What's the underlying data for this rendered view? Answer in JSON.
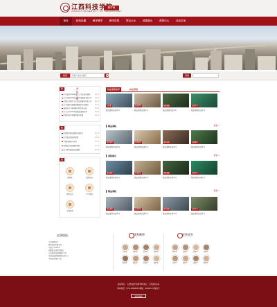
{
  "header": {
    "logo_text": "江西科技学院",
    "logo_sub": "JIANGXI UNIVERSITY OF TECHNOLOGY",
    "badge": "教学网"
  },
  "nav": {
    "items": [
      "首页",
      "机构设置",
      "教学教学",
      "教学改革",
      "项目公示",
      "成果展示",
      "资源中心",
      "互动交流"
    ],
    "active_index": 0
  },
  "search": {
    "label": "搜索",
    "placeholder": "请输入搜索关键词",
    "login_label": "登录"
  },
  "sidebar": {
    "news": {
      "tab_active": "新闻动态",
      "tab_other": "通知公告",
      "items": [
        {
          "text": "关于做好2019年教学工作安排的通知",
          "date": "03-18"
        },
        {
          "text": "关于开展2019年度教学成果奖申报工作",
          "date": "03-15"
        },
        {
          "text": "学院召开教学工作会议部署新学期工作",
          "date": "03-12"
        },
        {
          "text": "关于组织申报省级教改项目的通知",
          "date": "03-10"
        },
        {
          "text": "教务处关于期中教学检查的安排",
          "date": "03-08"
        },
        {
          "text": "关于公布2018年度精品课程名单",
          "date": "03-05"
        },
        {
          "text": "学院举办青年教师教学竞赛",
          "date": "03-01"
        }
      ]
    },
    "hot": {
      "title": "热门课程",
      "items": [
        {
          "text": "高等数学精品课程在线学习",
          "date": "03-18"
        },
        {
          "text": "大学英语视听说课程",
          "date": "03-16"
        },
        {
          "text": "计算机基础与应用",
          "date": "03-14"
        },
        {
          "text": "机械设计基础课程资源",
          "date": "03-12"
        },
        {
          "text": "电子商务概论在线课程",
          "date": "03-09"
        }
      ]
    },
    "services": {
      "title": "校园服务",
      "items": [
        "课程表",
        "成绩查询",
        "教学日历",
        "学习资源",
        "在线咨询",
        "图书馆"
      ]
    }
  },
  "main": {
    "tabs": [
      "精品课程推荐",
      "精品课程"
    ],
    "sections": [
      {
        "title": "精品课程",
        "more": "更多>>"
      },
      {
        "title": "精品课程",
        "more": "更多>>"
      },
      {
        "title": "课程展示",
        "more": "更多>>"
      },
      {
        "title": "精品课程",
        "more": "更多>>"
      }
    ],
    "cards": [
      [
        "公开课",
        "名师课堂",
        "微课展播",
        "在线学习"
      ],
      [
        "精品课程",
        "名师课堂",
        "教学视频",
        "实践教学"
      ],
      [
        "精品课程",
        "名师课堂",
        "微课展播",
        "在线学习"
      ],
      [
        "精品课程",
        "名师课堂",
        "教学视频",
        "在线学习"
      ]
    ],
    "card_caption": "精品课程在线学习"
  },
  "lower": {
    "links_title": "友情链接",
    "links": [
      "江西省教育厅",
      "教育部高等教育司",
      "中国大学MOOC",
      "国家精品课程资源网",
      "江西省高校网络教学平台",
      "全国高校教师网络培训中心",
      "中国高等教育学会"
    ],
    "teachers_title": "优秀教师",
    "teachers": [
      "王老师",
      "李老师",
      "张老师",
      "刘老师",
      "陈老师",
      "杨老师",
      "赵老师",
      "黄老师"
    ],
    "students_title": "优秀学生",
    "students": [
      "周同学",
      "吴同学",
      "徐同学",
      "孙同学",
      "马同学",
      "朱同学",
      "胡同学",
      "郭同学"
    ]
  },
  "footer": {
    "line1": "版权所有：江西科技学院教学网  地址：江西省南昌市",
    "line2": "联系电话：0791-88888888  邮编：330098  ICP备案号",
    "button": "返回顶部"
  },
  "colors": {
    "brand": "#a0121a",
    "footer": "#7a0f15"
  }
}
